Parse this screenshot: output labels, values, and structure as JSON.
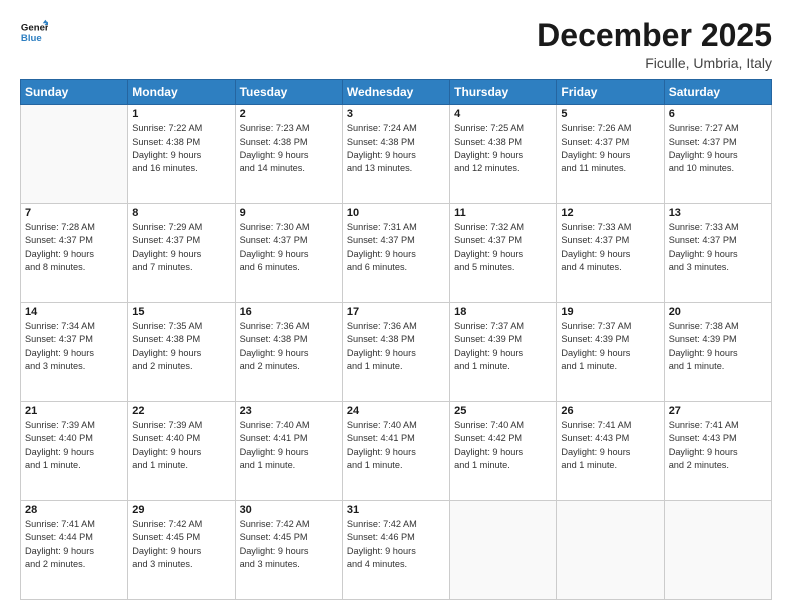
{
  "header": {
    "logo_line1": "General",
    "logo_line2": "Blue",
    "month": "December 2025",
    "location": "Ficulle, Umbria, Italy"
  },
  "days_of_week": [
    "Sunday",
    "Monday",
    "Tuesday",
    "Wednesday",
    "Thursday",
    "Friday",
    "Saturday"
  ],
  "weeks": [
    [
      {
        "day": "",
        "info": ""
      },
      {
        "day": "1",
        "info": "Sunrise: 7:22 AM\nSunset: 4:38 PM\nDaylight: 9 hours\nand 16 minutes."
      },
      {
        "day": "2",
        "info": "Sunrise: 7:23 AM\nSunset: 4:38 PM\nDaylight: 9 hours\nand 14 minutes."
      },
      {
        "day": "3",
        "info": "Sunrise: 7:24 AM\nSunset: 4:38 PM\nDaylight: 9 hours\nand 13 minutes."
      },
      {
        "day": "4",
        "info": "Sunrise: 7:25 AM\nSunset: 4:38 PM\nDaylight: 9 hours\nand 12 minutes."
      },
      {
        "day": "5",
        "info": "Sunrise: 7:26 AM\nSunset: 4:37 PM\nDaylight: 9 hours\nand 11 minutes."
      },
      {
        "day": "6",
        "info": "Sunrise: 7:27 AM\nSunset: 4:37 PM\nDaylight: 9 hours\nand 10 minutes."
      }
    ],
    [
      {
        "day": "7",
        "info": "Sunrise: 7:28 AM\nSunset: 4:37 PM\nDaylight: 9 hours\nand 8 minutes."
      },
      {
        "day": "8",
        "info": "Sunrise: 7:29 AM\nSunset: 4:37 PM\nDaylight: 9 hours\nand 7 minutes."
      },
      {
        "day": "9",
        "info": "Sunrise: 7:30 AM\nSunset: 4:37 PM\nDaylight: 9 hours\nand 6 minutes."
      },
      {
        "day": "10",
        "info": "Sunrise: 7:31 AM\nSunset: 4:37 PM\nDaylight: 9 hours\nand 6 minutes."
      },
      {
        "day": "11",
        "info": "Sunrise: 7:32 AM\nSunset: 4:37 PM\nDaylight: 9 hours\nand 5 minutes."
      },
      {
        "day": "12",
        "info": "Sunrise: 7:33 AM\nSunset: 4:37 PM\nDaylight: 9 hours\nand 4 minutes."
      },
      {
        "day": "13",
        "info": "Sunrise: 7:33 AM\nSunset: 4:37 PM\nDaylight: 9 hours\nand 3 minutes."
      }
    ],
    [
      {
        "day": "14",
        "info": "Sunrise: 7:34 AM\nSunset: 4:37 PM\nDaylight: 9 hours\nand 3 minutes."
      },
      {
        "day": "15",
        "info": "Sunrise: 7:35 AM\nSunset: 4:38 PM\nDaylight: 9 hours\nand 2 minutes."
      },
      {
        "day": "16",
        "info": "Sunrise: 7:36 AM\nSunset: 4:38 PM\nDaylight: 9 hours\nand 2 minutes."
      },
      {
        "day": "17",
        "info": "Sunrise: 7:36 AM\nSunset: 4:38 PM\nDaylight: 9 hours\nand 1 minute."
      },
      {
        "day": "18",
        "info": "Sunrise: 7:37 AM\nSunset: 4:39 PM\nDaylight: 9 hours\nand 1 minute."
      },
      {
        "day": "19",
        "info": "Sunrise: 7:37 AM\nSunset: 4:39 PM\nDaylight: 9 hours\nand 1 minute."
      },
      {
        "day": "20",
        "info": "Sunrise: 7:38 AM\nSunset: 4:39 PM\nDaylight: 9 hours\nand 1 minute."
      }
    ],
    [
      {
        "day": "21",
        "info": "Sunrise: 7:39 AM\nSunset: 4:40 PM\nDaylight: 9 hours\nand 1 minute."
      },
      {
        "day": "22",
        "info": "Sunrise: 7:39 AM\nSunset: 4:40 PM\nDaylight: 9 hours\nand 1 minute."
      },
      {
        "day": "23",
        "info": "Sunrise: 7:40 AM\nSunset: 4:41 PM\nDaylight: 9 hours\nand 1 minute."
      },
      {
        "day": "24",
        "info": "Sunrise: 7:40 AM\nSunset: 4:41 PM\nDaylight: 9 hours\nand 1 minute."
      },
      {
        "day": "25",
        "info": "Sunrise: 7:40 AM\nSunset: 4:42 PM\nDaylight: 9 hours\nand 1 minute."
      },
      {
        "day": "26",
        "info": "Sunrise: 7:41 AM\nSunset: 4:43 PM\nDaylight: 9 hours\nand 1 minute."
      },
      {
        "day": "27",
        "info": "Sunrise: 7:41 AM\nSunset: 4:43 PM\nDaylight: 9 hours\nand 2 minutes."
      }
    ],
    [
      {
        "day": "28",
        "info": "Sunrise: 7:41 AM\nSunset: 4:44 PM\nDaylight: 9 hours\nand 2 minutes."
      },
      {
        "day": "29",
        "info": "Sunrise: 7:42 AM\nSunset: 4:45 PM\nDaylight: 9 hours\nand 3 minutes."
      },
      {
        "day": "30",
        "info": "Sunrise: 7:42 AM\nSunset: 4:45 PM\nDaylight: 9 hours\nand 3 minutes."
      },
      {
        "day": "31",
        "info": "Sunrise: 7:42 AM\nSunset: 4:46 PM\nDaylight: 9 hours\nand 4 minutes."
      },
      {
        "day": "",
        "info": ""
      },
      {
        "day": "",
        "info": ""
      },
      {
        "day": "",
        "info": ""
      }
    ]
  ]
}
